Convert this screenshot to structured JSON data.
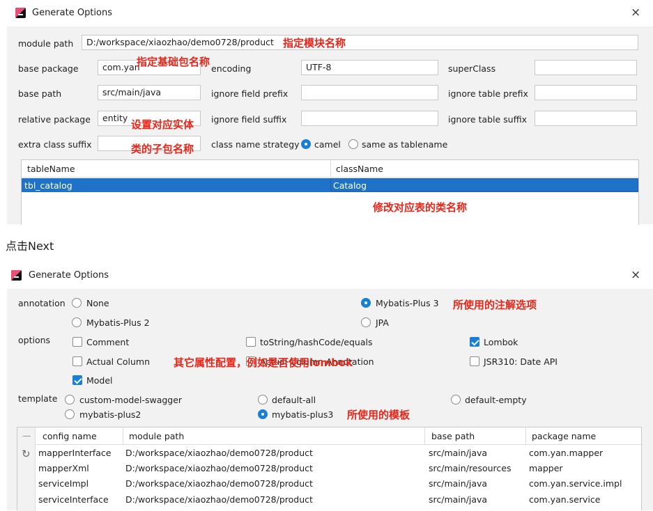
{
  "dialog1": {
    "title": "Generate Options",
    "close_symbol": "×",
    "module_path_label": "module path",
    "module_path_value": "D:/workspace/xiaozhao/demo0728/product",
    "base_package_label": "base package",
    "base_package_value": "com.yan",
    "encoding_label": "encoding",
    "encoding_value": "UTF-8",
    "superclass_label": "superClass",
    "superclass_value": "",
    "base_path_label": "base path",
    "base_path_value": "src/main/java",
    "ignore_field_prefix_label": "ignore field prefix",
    "ignore_field_prefix_value": "",
    "ignore_table_prefix_label": "ignore table prefix",
    "ignore_table_prefix_value": "",
    "relative_package_label": "relative package",
    "relative_package_value": "entity",
    "ignore_field_suffix_label": "ignore field suffix",
    "ignore_field_suffix_value": "",
    "ignore_table_suffix_label": "ignore table suffix",
    "ignore_table_suffix_value": "",
    "extra_class_suffix_label": "extra class suffix",
    "extra_class_suffix_value": "",
    "class_name_strategy_label": "class name strategy",
    "strategy_options": [
      {
        "label": "camel",
        "selected": true
      },
      {
        "label": "same as tablename",
        "selected": false
      }
    ],
    "table": {
      "headers": [
        "tableName",
        "className"
      ],
      "rows": [
        [
          "tbl_catalog",
          "Catalog"
        ]
      ]
    },
    "annotations": {
      "module_name": "指定模块名称",
      "base_package": "指定基础包名称",
      "entity_line1": "设置对应实体",
      "entity_line2": "类的子包名称",
      "class_name": "修改对应表的类名称"
    }
  },
  "between_text": "点击Next",
  "dialog2": {
    "title": "Generate Options",
    "close_symbol": "×",
    "annotation_label": "annotation",
    "annotation_options": [
      {
        "label": "None",
        "selected": false
      },
      {
        "label": "Mybatis-Plus 3",
        "selected": true
      },
      {
        "label": "Mybatis-Plus 2",
        "selected": false
      },
      {
        "label": "JPA",
        "selected": false
      }
    ],
    "options_label": "options",
    "options": [
      {
        "label": "Comment",
        "checked": false
      },
      {
        "label": "toString/hashCode/equals",
        "checked": false
      },
      {
        "label": "Lombok",
        "checked": true
      },
      {
        "label": "Actual Column",
        "checked": false
      },
      {
        "label": "Actual Column Annotation",
        "checked": false
      },
      {
        "label": "JSR310: Date API",
        "checked": false
      },
      {
        "label": "Model",
        "checked": true
      }
    ],
    "template_label": "template",
    "templates": [
      {
        "label": "custom-model-swagger",
        "selected": false
      },
      {
        "label": "default-all",
        "selected": false
      },
      {
        "label": "default-empty",
        "selected": false
      },
      {
        "label": "mybatis-plus2",
        "selected": false
      },
      {
        "label": "mybatis-plus3",
        "selected": true
      }
    ],
    "table": {
      "side_symbols": [
        "—",
        "↻"
      ],
      "headers": [
        "config name",
        "module path",
        "base path",
        "package name"
      ],
      "rows": [
        [
          "mapperInterface",
          "D:/workspace/xiaozhao/demo0728/product",
          "src/main/java",
          "com.yan.mapper"
        ],
        [
          "mapperXml",
          "D:/workspace/xiaozhao/demo0728/product",
          "src/main/resources",
          "mapper"
        ],
        [
          "serviceImpl",
          "D:/workspace/xiaozhao/demo0728/product",
          "src/main/java",
          "com.yan.service.impl"
        ],
        [
          "serviceInterface",
          "D:/workspace/xiaozhao/demo0728/product",
          "src/main/java",
          "com.yan.service"
        ]
      ]
    },
    "annotations": {
      "annotation_choice": "所使用的注解选项",
      "other_config": "其它属性配置，例如是否使用lombok",
      "template_choice": "所使用的模板"
    }
  },
  "colors": {
    "accent": "#1a7fd4",
    "selection": "#1e73c8",
    "annotation_red": "#e8261a"
  },
  "icons": [
    "app-logo-icon",
    "close-icon",
    "refresh-icon",
    "collapse-icon"
  ]
}
